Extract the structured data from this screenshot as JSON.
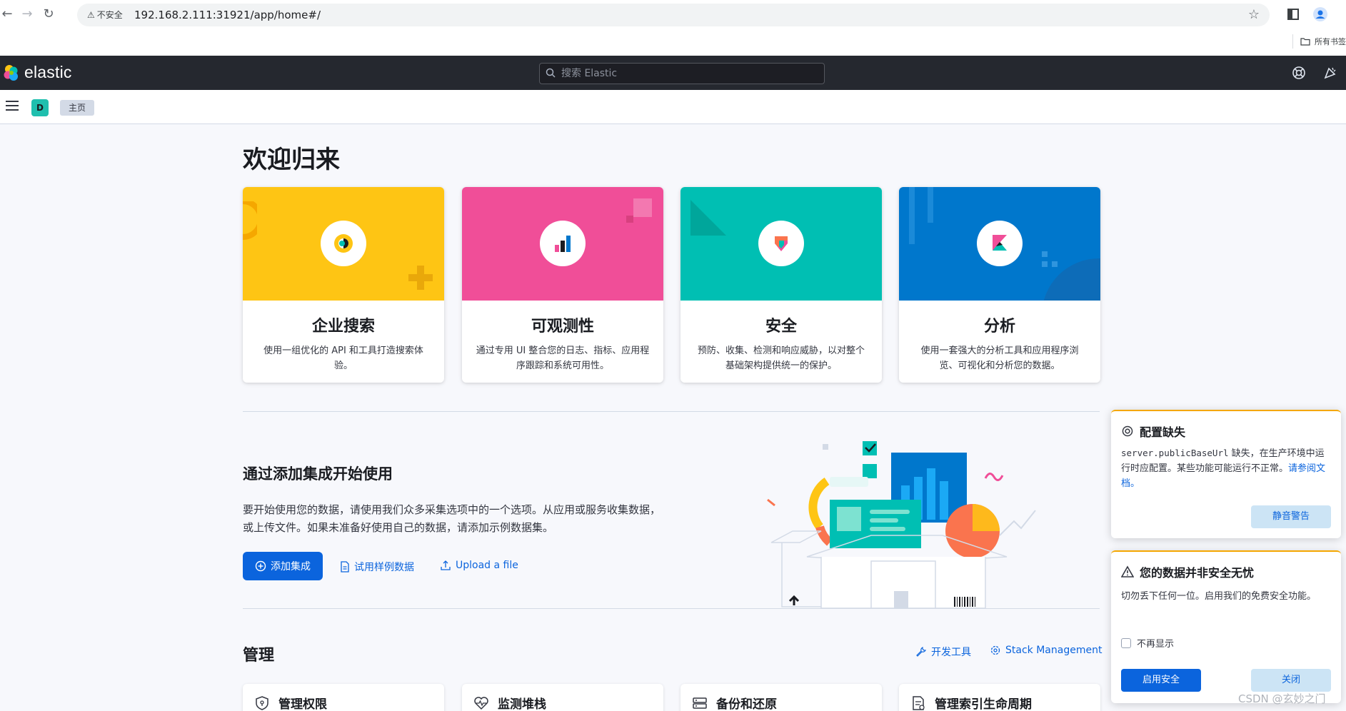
{
  "browser": {
    "security_label": "不安全",
    "url": "192.168.2.111:31921/app/home#/",
    "bookmarks_label": "所有书签"
  },
  "header": {
    "logo_text": "elastic",
    "search_placeholder": "搜索 Elastic"
  },
  "breadcrumb": {
    "space_initial": "D",
    "current": "主页"
  },
  "page": {
    "title": "欢迎归来"
  },
  "solutions": [
    {
      "title": "企业搜索",
      "description": "使用一组优化的 API 和工具打造搜索体验。",
      "color": "#fec514",
      "icon": "enterprise-search-icon"
    },
    {
      "title": "可观测性",
      "description": "通过专用 UI 整合您的日志、指标、应用程序跟踪和系统可用性。",
      "color": "#f04e98",
      "icon": "observability-icon"
    },
    {
      "title": "安全",
      "description": "预防、收集、检测和响应威胁，以对整个基础架构提供统一的保护。",
      "color": "#00bfb3",
      "icon": "security-icon"
    },
    {
      "title": "分析",
      "description": "使用一套强大的分析工具和应用程序浏览、可视化和分析您的数据。",
      "color": "#0077cc",
      "icon": "kibana-icon"
    }
  ],
  "ingest": {
    "title": "通过添加集成开始使用",
    "description": "要开始使用您的数据，请使用我们众多采集选项中的一个选项。从应用或服务收集数据，或上传文件。如果未准备好使用自己的数据，请添加示例数据集。",
    "add_integrations": "添加集成",
    "sample_data": "试用样例数据",
    "upload_file": "Upload a file"
  },
  "management": {
    "title": "管理",
    "dev_tools": "开发工具",
    "stack_management": "Stack Management",
    "cards": [
      "管理权限",
      "监测堆栈",
      "备份和还原",
      "管理索引生命周期"
    ]
  },
  "toasts": {
    "config": {
      "title": "配置缺失",
      "code": "server.publicBaseUrl",
      "body": " 缺失，在生产环境中运行时应配置。某些功能可能运行不正常。",
      "link": "请参阅文档。",
      "mute": "静音警告"
    },
    "security": {
      "title": "您的数据并非安全无忧",
      "body": "切勿丢下任何一位。启用我们的免费安全功能。",
      "dont_show": "不再显示",
      "enable": "启用安全",
      "close": "关闭"
    }
  },
  "watermark": "CSDN @玄妙之门"
}
